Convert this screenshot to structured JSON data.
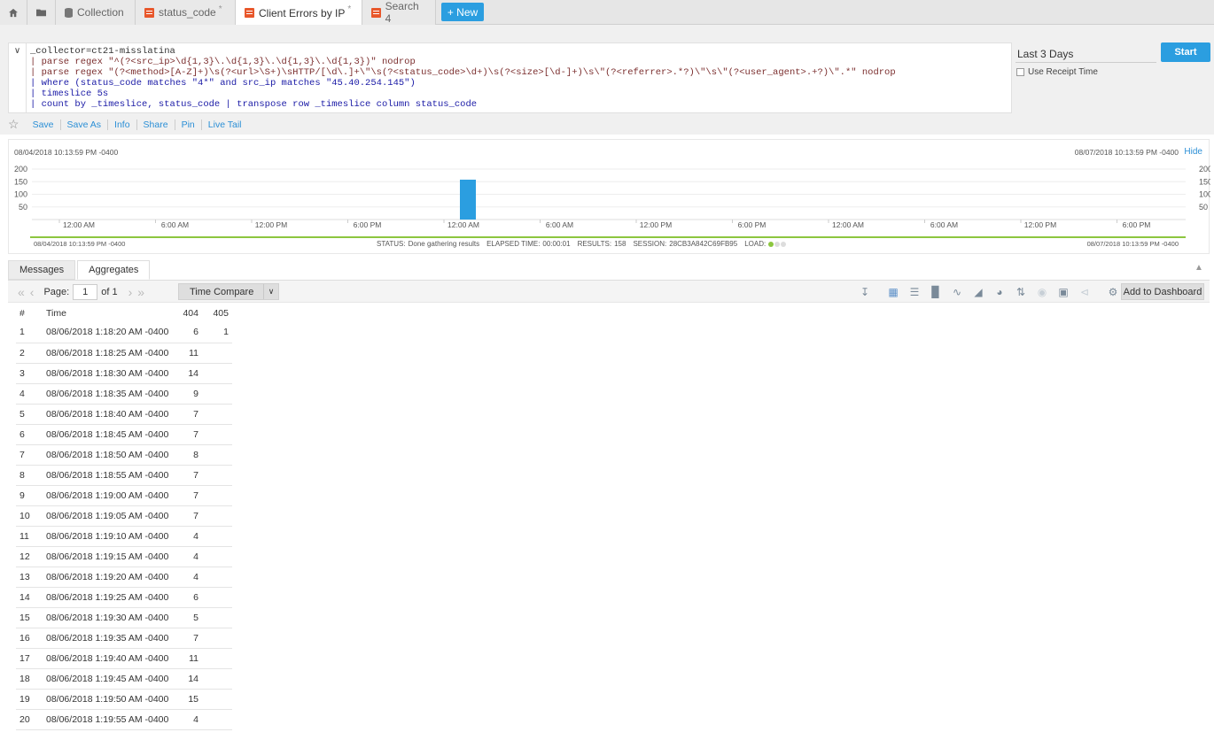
{
  "tabs": {
    "home_icon": "home-icon",
    "folder_icon": "folder-icon",
    "items": [
      {
        "label": "Collection",
        "modified": ""
      },
      {
        "label": "status_code",
        "modified": "*"
      },
      {
        "label": "Client Errors by IP",
        "modified": "*"
      },
      {
        "label": "Search 4",
        "modified": ""
      }
    ],
    "new_label": "+ New"
  },
  "query": {
    "lines": [
      "_collector=ct21-misslatina",
      "| parse regex \"^(?<src_ip>\\d{1,3}\\.\\d{1,3}\\.\\d{1,3}\\.\\d{1,3})\" nodrop",
      "| parse regex \"(?<method>[A-Z]+)\\s(?<url>\\S+)\\sHTTP/[\\d\\.]+\\\"\\s(?<status_code>\\d+)\\s(?<size>[\\d-]+)\\s\\\"(?<referrer>.*?)\\\"\\s\\\"(?<user_agent>.+?)\\\".*\" nodrop",
      "| where (status_code matches \"4*\" and src_ip matches \"45.40.254.145\")",
      "| timeslice 5s",
      "| count by _timeslice, status_code | transpose row _timeslice column status_code"
    ],
    "time_range": "Last 3 Days",
    "start_label": "Start",
    "use_receipt_label": "Use Receipt Time"
  },
  "actions": [
    "Save",
    "Save As",
    "Info",
    "Share",
    "Pin",
    "Live Tail"
  ],
  "histogram": {
    "start_label": "08/04/2018 10:13:59 PM -0400",
    "end_label": "08/07/2018 10:13:59 PM -0400",
    "hide_label": "Hide",
    "y_ticks": [
      "200",
      "150",
      "100",
      "50"
    ],
    "x_ticks": [
      "12:00 AM",
      "6:00 AM",
      "12:00 PM",
      "6:00 PM",
      "12:00 AM",
      "6:00 AM",
      "12:00 PM",
      "6:00 PM",
      "12:00 AM",
      "6:00 AM",
      "12:00 PM",
      "6:00 PM"
    ],
    "range_start": "08/04/2018 10:13:59 PM -0400",
    "range_end": "08/07/2018 10:13:59 PM -0400",
    "status_key": "STATUS:",
    "status_val": "Done gathering results",
    "elapsed_key": "ELAPSED TIME:",
    "elapsed_val": "00:00:01",
    "results_key": "RESULTS:",
    "results_val": "158",
    "session_key": "SESSION:",
    "session_val": "28CB3A842C69FB95",
    "load_key": "LOAD:",
    "bar_color": "#2b9ee0"
  },
  "chart_data": {
    "type": "bar",
    "title": "",
    "xlabel": "",
    "ylabel": "",
    "ylim": [
      0,
      200
    ],
    "x": [
      "08/06/2018 1:00 AM"
    ],
    "values": [
      158
    ]
  },
  "results": {
    "tabs": [
      "Messages",
      "Aggregates"
    ],
    "page_label": "Page:",
    "page_value": "1",
    "page_of": "of 1",
    "time_compare_label": "Time Compare",
    "add_dashboard_label": "Add to Dashboard",
    "columns": [
      "#",
      "Time",
      "404",
      "405"
    ],
    "rows": [
      [
        "1",
        "08/06/2018 1:18:20 AM -0400",
        "6",
        "1"
      ],
      [
        "2",
        "08/06/2018 1:18:25 AM -0400",
        "11",
        ""
      ],
      [
        "3",
        "08/06/2018 1:18:30 AM -0400",
        "14",
        ""
      ],
      [
        "4",
        "08/06/2018 1:18:35 AM -0400",
        "9",
        ""
      ],
      [
        "5",
        "08/06/2018 1:18:40 AM -0400",
        "7",
        ""
      ],
      [
        "6",
        "08/06/2018 1:18:45 AM -0400",
        "7",
        ""
      ],
      [
        "7",
        "08/06/2018 1:18:50 AM -0400",
        "8",
        ""
      ],
      [
        "8",
        "08/06/2018 1:18:55 AM -0400",
        "7",
        ""
      ],
      [
        "9",
        "08/06/2018 1:19:00 AM -0400",
        "7",
        ""
      ],
      [
        "10",
        "08/06/2018 1:19:05 AM -0400",
        "7",
        ""
      ],
      [
        "11",
        "08/06/2018 1:19:10 AM -0400",
        "4",
        ""
      ],
      [
        "12",
        "08/06/2018 1:19:15 AM -0400",
        "4",
        ""
      ],
      [
        "13",
        "08/06/2018 1:19:20 AM -0400",
        "4",
        ""
      ],
      [
        "14",
        "08/06/2018 1:19:25 AM -0400",
        "6",
        ""
      ],
      [
        "15",
        "08/06/2018 1:19:30 AM -0400",
        "5",
        ""
      ],
      [
        "16",
        "08/06/2018 1:19:35 AM -0400",
        "7",
        ""
      ],
      [
        "17",
        "08/06/2018 1:19:40 AM -0400",
        "11",
        ""
      ],
      [
        "18",
        "08/06/2018 1:19:45 AM -0400",
        "14",
        ""
      ],
      [
        "19",
        "08/06/2018 1:19:50 AM -0400",
        "15",
        ""
      ],
      [
        "20",
        "08/06/2018 1:19:55 AM -0400",
        "4",
        ""
      ]
    ]
  }
}
